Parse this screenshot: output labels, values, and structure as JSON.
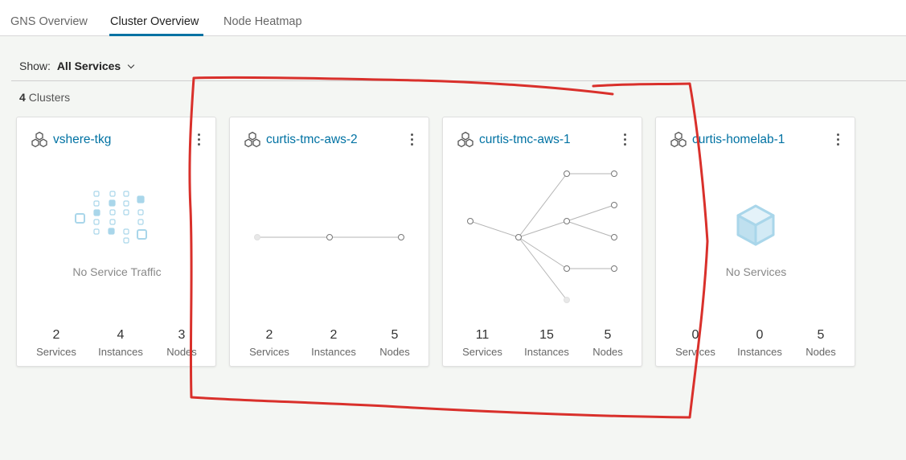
{
  "tabs": [
    {
      "label": "GNS Overview"
    },
    {
      "label": "Cluster Overview"
    },
    {
      "label": "Node Heatmap"
    }
  ],
  "filter": {
    "label": "Show:",
    "value": "All Services"
  },
  "cluster_count": {
    "value": "4",
    "label": "Clusters"
  },
  "clusters": [
    {
      "name": "vshere-tkg",
      "message": "No Service Traffic",
      "stats": [
        {
          "value": "2",
          "label": "Services"
        },
        {
          "value": "4",
          "label": "Instances"
        },
        {
          "value": "3",
          "label": "Nodes"
        }
      ]
    },
    {
      "name": "curtis-tmc-aws-2",
      "stats": [
        {
          "value": "2",
          "label": "Services"
        },
        {
          "value": "2",
          "label": "Instances"
        },
        {
          "value": "5",
          "label": "Nodes"
        }
      ]
    },
    {
      "name": "curtis-tmc-aws-1",
      "stats": [
        {
          "value": "11",
          "label": "Services"
        },
        {
          "value": "15",
          "label": "Instances"
        },
        {
          "value": "5",
          "label": "Nodes"
        }
      ]
    },
    {
      "name": "curtis-homelab-1",
      "message": "No Services",
      "stats": [
        {
          "value": "0",
          "label": "Services"
        },
        {
          "value": "0",
          "label": "Instances"
        },
        {
          "value": "5",
          "label": "Nodes"
        }
      ]
    }
  ],
  "colors": {
    "accent": "#0072a3",
    "annotation": "#d9302b",
    "background": "#f4f6f3"
  }
}
